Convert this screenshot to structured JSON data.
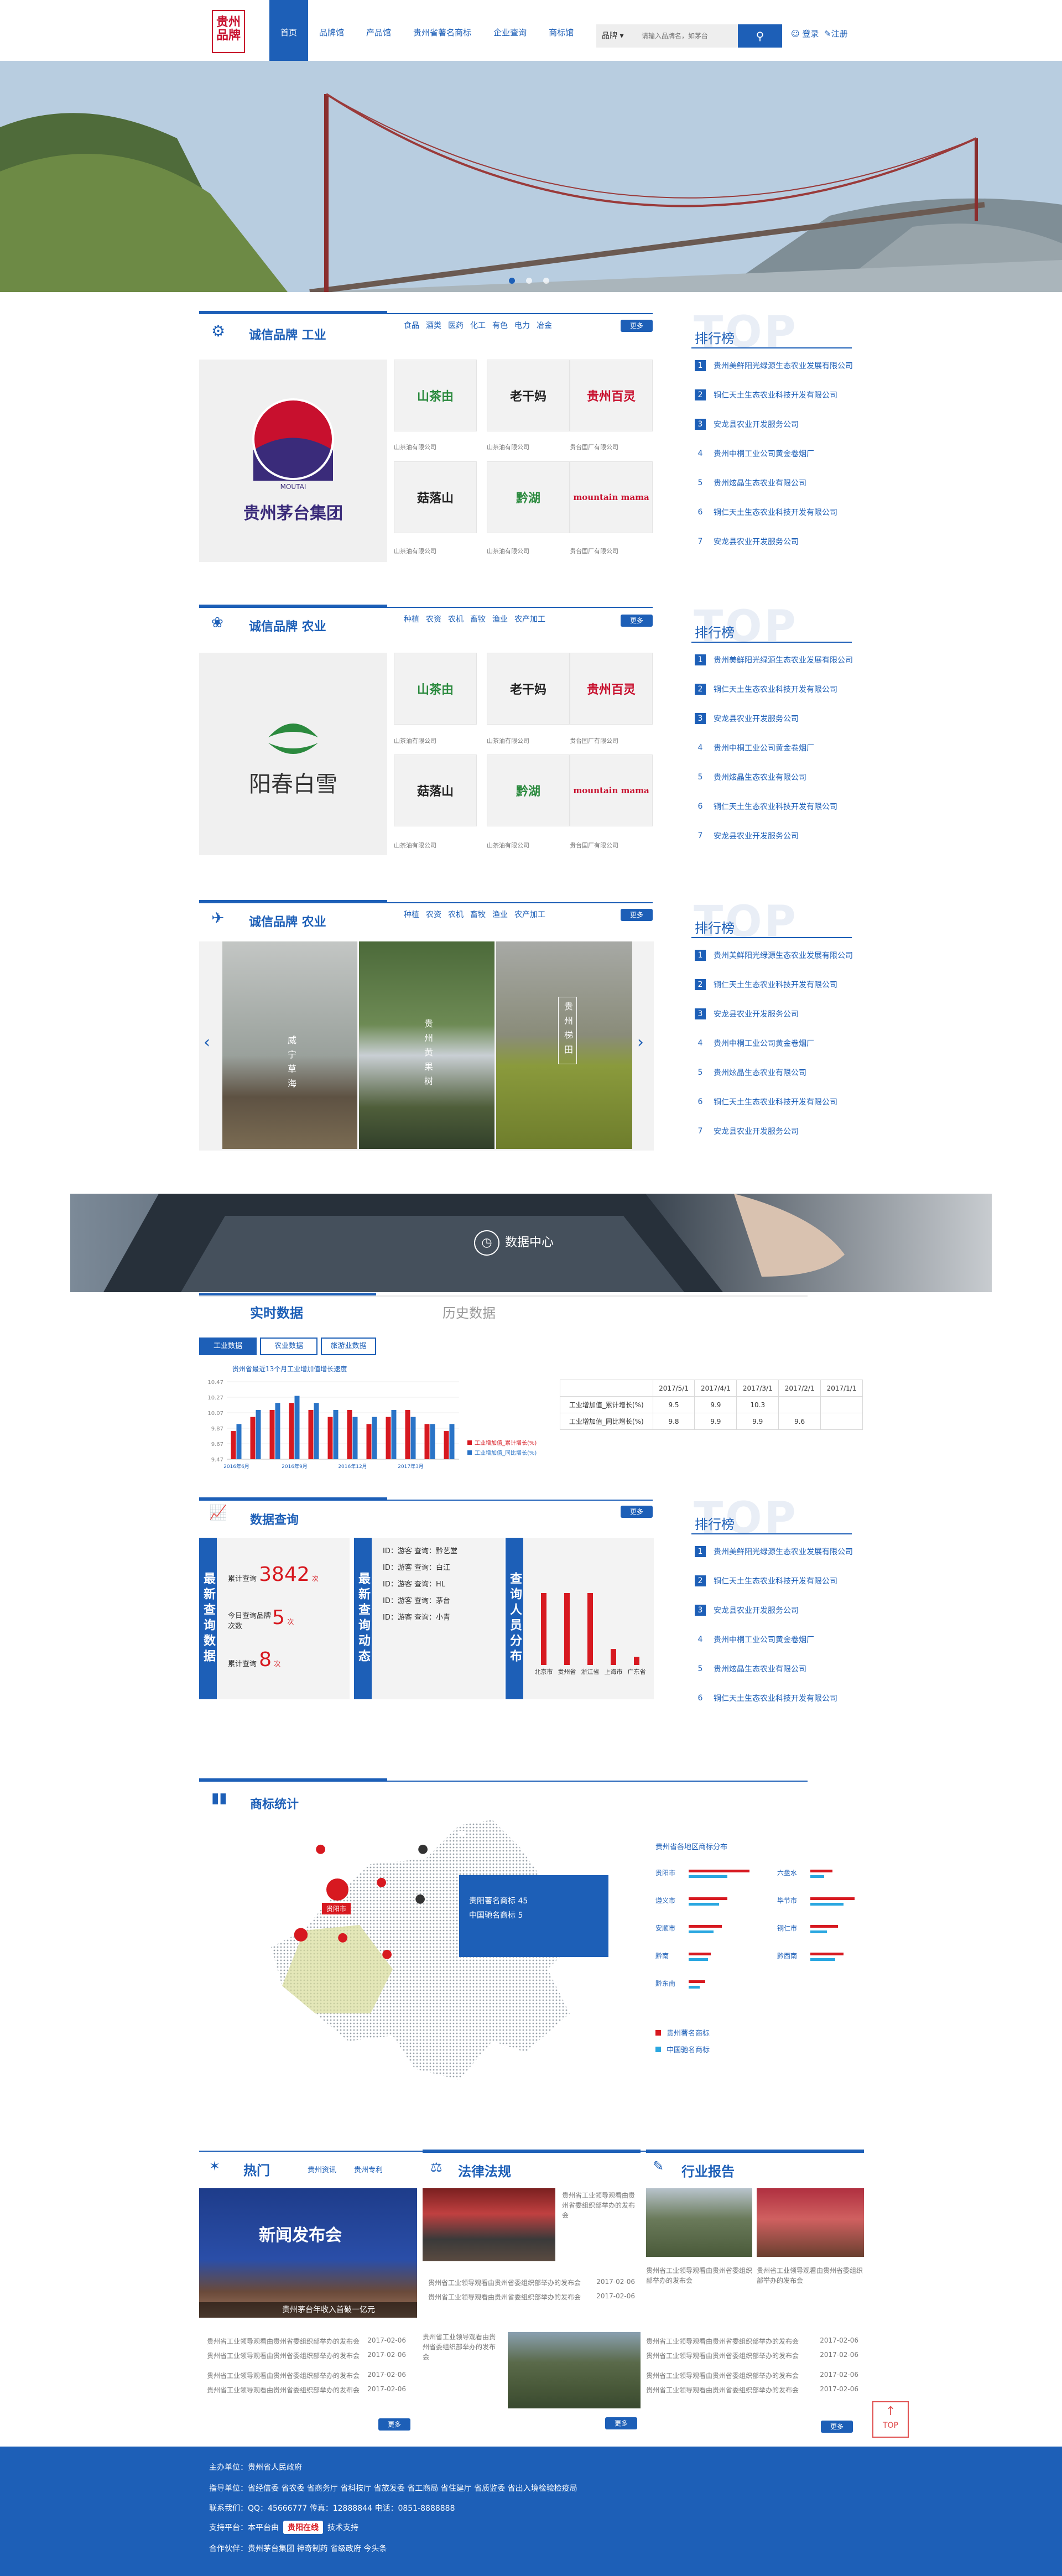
{
  "header": {
    "logo_text": "贵州品牌",
    "nav": [
      "首页",
      "品牌馆",
      "产品馆",
      "贵州省著名商标",
      "企业查询",
      "商标馆"
    ],
    "search_select": "品牌",
    "search_placeholder": "请输入品牌名，如茅台",
    "login": "登录",
    "register": "注册"
  },
  "section1": {
    "title": "诚信品牌 工业",
    "cats": [
      "食品",
      "酒类",
      "医药",
      "化工",
      "有色",
      "电力",
      "冶金"
    ],
    "more": "更多",
    "big_logo": "贵州茅台集团",
    "big_brand": "MOUTAI",
    "tiles": [
      {
        "name": "山茶由",
        "cap": "山茶油有限公司"
      },
      {
        "name": "老干妈",
        "cap": "山茶油有限公司"
      },
      {
        "name": "贵州百灵",
        "cap": "贵台国厂有限公司"
      },
      {
        "name": "菇落山",
        "cap": "山茶油有限公司"
      },
      {
        "name": "黔湖",
        "cap": "山茶油有限公司"
      },
      {
        "name": "mountain mama",
        "cap": "贵台国厂有限公司"
      }
    ]
  },
  "rank": {
    "title": "排行榜",
    "bg": "TOP",
    "items": [
      "贵州美鲜阳光绿源生态农业发展有限公司",
      "铜仁天土生态农业科技开发有限公司",
      "安龙县农业开发服务公司",
      "贵州中桐工业公司黄金卷烟厂",
      "贵州炫晶生态农业有限公司",
      "铜仁天土生态农业科技开发有限公司",
      "安龙县农业开发服务公司"
    ]
  },
  "section2": {
    "title": "诚信品牌 农业",
    "cats": [
      "种植",
      "农资",
      "农机",
      "畜牧",
      "渔业",
      "农产加工"
    ],
    "more": "更多",
    "big_logo": "阳春白雪"
  },
  "section3": {
    "title": "诚信品牌 农业",
    "cats": [
      "种植",
      "农资",
      "农机",
      "畜牧",
      "渔业",
      "农产加工"
    ],
    "more": "更多",
    "photos": [
      "威宁草海",
      "贵州黄果树",
      "贵州梯田"
    ]
  },
  "data_center": {
    "banner": "数据中心",
    "tab_live": "实时数据",
    "tab_history": "历史数据",
    "buttons": [
      "工业数据",
      "农业数据",
      "旅游业数据"
    ],
    "chart_title": "贵州省最近13个月工业增加值增长速度",
    "legend": [
      "工业增加值_累计增长(%)",
      "工业增加值_同比增长(%)"
    ],
    "table_head": [
      "",
      "2017/5/1",
      "2017/4/1",
      "2017/3/1",
      "2017/2/1",
      "2017/1/1"
    ],
    "table_rows": [
      [
        "工业增加值_累计增长(%)",
        "9.5",
        "9.9",
        "10.3",
        "",
        ""
      ],
      [
        "工业增加值_同比增长(%)",
        "9.8",
        "9.9",
        "9.9",
        "9.6",
        ""
      ]
    ]
  },
  "chart_data": {
    "type": "bar",
    "title": "贵州省最近13个月工业增加值增长速度",
    "categories": [
      "2016年6月",
      "2016年7月",
      "2016年8月",
      "2016年9月",
      "2016年10月",
      "2016年11月",
      "2016年12月",
      "2017年1月",
      "2017年2月",
      "2017年3月",
      "2017年4月",
      "2017年5月"
    ],
    "series": [
      {
        "name": "工业增加值_累计增长(%)",
        "values": [
          9.8,
          10.0,
          10.1,
          10.2,
          10.1,
          10.0,
          10.1,
          9.9,
          10.0,
          10.1,
          9.9,
          9.8
        ]
      },
      {
        "name": "工业增加值_同比增长(%)",
        "values": [
          9.9,
          10.1,
          10.2,
          10.3,
          10.2,
          10.1,
          10.0,
          10.0,
          10.1,
          10.0,
          9.9,
          9.9
        ]
      }
    ],
    "ylim": [
      9.4,
      10.5
    ],
    "yticks": [
      "10.47",
      "10.27",
      "10.07",
      "9.87",
      "9.67",
      "9.47"
    ],
    "xticks": [
      "2016年6月",
      "2016年9月",
      "2016年12月",
      "2017年3月"
    ]
  },
  "query": {
    "title": "数据查询",
    "more": "更多",
    "col1": "最新查询数据",
    "stat1_label": "累计查询",
    "stat1_value": "3842",
    "stat1_unit": "次",
    "stat2_label": "今日查询品牌次数",
    "stat2_value": "5",
    "stat2_unit": "次",
    "stat3_label": "累计查询",
    "stat3_value": "8",
    "stat3_unit": "次",
    "col2": "最新查询动态",
    "records": [
      "ID：游客 查询：黔艺堂",
      "ID：游客 查询：白江",
      "ID：游客 查询：HL",
      "ID：游客 查询：茅台",
      "ID：游客 查询：小青"
    ],
    "col3": "查询人员分布",
    "cities": [
      "北京市",
      "贵州省",
      "浙江省",
      "上海市",
      "广东省"
    ],
    "city_values": [
      9,
      9,
      9,
      2,
      1
    ],
    "rank_items": [
      "贵州美鲜阳光绿源生态农业发展有限公司",
      "铜仁天土生态农业科技开发有限公司",
      "安龙县农业开发服务公司",
      "贵州中桐工业公司黄金卷烟厂",
      "贵州炫晶生态农业有限公司",
      "铜仁天土生态农业科技开发有限公司"
    ]
  },
  "trademark": {
    "title": "商标统计",
    "map_caption": "贵州省各地区商标分布",
    "popup_line1": "贵阳著名商标 45",
    "popup_line2": "中国驰名商标 5",
    "pin_label": "贵阳市",
    "regions_left": [
      "贵阳市",
      "遵义市",
      "安顺市",
      "黔南",
      "黔东南"
    ],
    "regions_right": [
      "六盘水",
      "毕节市",
      "铜仁市",
      "黔西南"
    ],
    "legend": [
      "贵州著名商标",
      "中国驰名商标"
    ],
    "colors": {
      "famous": "#d71920",
      "china": "#2aa7e0"
    }
  },
  "news": {
    "hot_title": "热门",
    "hot_tabs": [
      "贵州资讯",
      "贵州专利"
    ],
    "hot_img": "新闻发布会",
    "hot_img_caption": "贵州茅台年收入首破一亿元",
    "law_title": "法律法规",
    "report_title": "行业报告",
    "more": "更多",
    "item_text": "贵州省工业领导观看由贵州省委组织部举办的发布会",
    "date": "2017-02-06"
  },
  "footer": {
    "line1": "主办单位：贵州省人民政府",
    "line2": "指导单位：省经信委 省农委 省商务厅 省科技厅 省旅发委 省工商局 省住建厅 省质监委 省出入境检验检疫局",
    "line3": "联系我们：QQ：45666777 传真：12888844 电话：0851-8888888",
    "line4_prefix": "支持平台：本平台由",
    "line4_brand": "贵阳在线",
    "line4_suffix": "技术支持",
    "line5": "合作伙伴：贵州茅台集团 神奇制药 省级政府 今头条",
    "top": "TOP"
  }
}
